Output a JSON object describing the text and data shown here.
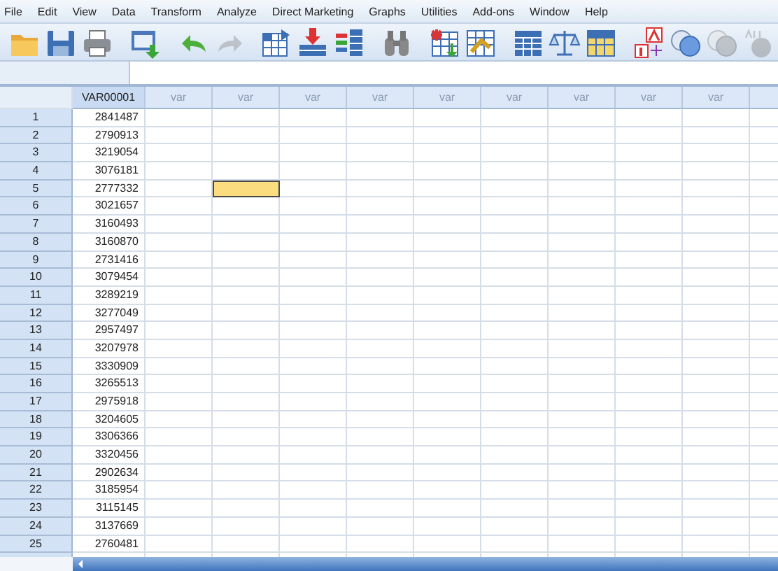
{
  "menu": [
    "File",
    "Edit",
    "View",
    "Data",
    "Transform",
    "Analyze",
    "Direct Marketing",
    "Graphs",
    "Utilities",
    "Add-ons",
    "Window",
    "Help"
  ],
  "toolbar": [
    {
      "kind": "folder",
      "disabled": false
    },
    {
      "kind": "save",
      "disabled": false
    },
    {
      "kind": "print",
      "disabled": false
    },
    {
      "kind": "dialog",
      "disabled": false
    },
    {
      "kind": "undo",
      "disabled": false
    },
    {
      "kind": "redo",
      "disabled": true
    },
    {
      "kind": "grid-arrow",
      "disabled": false
    },
    {
      "kind": "grid-down",
      "disabled": false
    },
    {
      "kind": "variables",
      "disabled": false
    },
    {
      "kind": "find",
      "disabled": false
    },
    {
      "kind": "insert",
      "disabled": false
    },
    {
      "kind": "split",
      "disabled": false
    },
    {
      "kind": "table",
      "disabled": false
    },
    {
      "kind": "scale",
      "disabled": false
    },
    {
      "kind": "table-yellow",
      "disabled": false
    },
    {
      "kind": "labels",
      "disabled": false
    },
    {
      "kind": "circles",
      "disabled": false
    },
    {
      "kind": "circles",
      "disabled": true
    },
    {
      "kind": "spell",
      "disabled": true
    }
  ],
  "columns": [
    "VAR00001",
    "var",
    "var",
    "var",
    "var",
    "var",
    "var",
    "var",
    "var",
    "var"
  ],
  "rows": [
    {
      "case": "1",
      "value": "2841487",
      "cells": [
        {
          "selected": false
        },
        {
          "selected": false
        },
        {
          "selected": false
        },
        {
          "selected": false
        },
        {
          "selected": false
        },
        {
          "selected": false
        },
        {
          "selected": false
        },
        {
          "selected": false
        },
        {
          "selected": false
        }
      ]
    },
    {
      "case": "2",
      "value": "2790913",
      "cells": [
        {
          "selected": false
        },
        {
          "selected": false
        },
        {
          "selected": false
        },
        {
          "selected": false
        },
        {
          "selected": false
        },
        {
          "selected": false
        },
        {
          "selected": false
        },
        {
          "selected": false
        },
        {
          "selected": false
        }
      ]
    },
    {
      "case": "3",
      "value": "3219054",
      "cells": [
        {
          "selected": false
        },
        {
          "selected": false
        },
        {
          "selected": false
        },
        {
          "selected": false
        },
        {
          "selected": false
        },
        {
          "selected": false
        },
        {
          "selected": false
        },
        {
          "selected": false
        },
        {
          "selected": false
        }
      ]
    },
    {
      "case": "4",
      "value": "3076181",
      "cells": [
        {
          "selected": false
        },
        {
          "selected": false
        },
        {
          "selected": false
        },
        {
          "selected": false
        },
        {
          "selected": false
        },
        {
          "selected": false
        },
        {
          "selected": false
        },
        {
          "selected": false
        },
        {
          "selected": false
        }
      ]
    },
    {
      "case": "5",
      "value": "2777332",
      "cells": [
        {
          "selected": false
        },
        {
          "selected": true
        },
        {
          "selected": false
        },
        {
          "selected": false
        },
        {
          "selected": false
        },
        {
          "selected": false
        },
        {
          "selected": false
        },
        {
          "selected": false
        },
        {
          "selected": false
        }
      ]
    },
    {
      "case": "6",
      "value": "3021657",
      "cells": [
        {
          "selected": false
        },
        {
          "selected": false
        },
        {
          "selected": false
        },
        {
          "selected": false
        },
        {
          "selected": false
        },
        {
          "selected": false
        },
        {
          "selected": false
        },
        {
          "selected": false
        },
        {
          "selected": false
        }
      ]
    },
    {
      "case": "7",
      "value": "3160493",
      "cells": [
        {
          "selected": false
        },
        {
          "selected": false
        },
        {
          "selected": false
        },
        {
          "selected": false
        },
        {
          "selected": false
        },
        {
          "selected": false
        },
        {
          "selected": false
        },
        {
          "selected": false
        },
        {
          "selected": false
        }
      ]
    },
    {
      "case": "8",
      "value": "3160870",
      "cells": [
        {
          "selected": false
        },
        {
          "selected": false
        },
        {
          "selected": false
        },
        {
          "selected": false
        },
        {
          "selected": false
        },
        {
          "selected": false
        },
        {
          "selected": false
        },
        {
          "selected": false
        },
        {
          "selected": false
        }
      ]
    },
    {
      "case": "9",
      "value": "2731416",
      "cells": [
        {
          "selected": false
        },
        {
          "selected": false
        },
        {
          "selected": false
        },
        {
          "selected": false
        },
        {
          "selected": false
        },
        {
          "selected": false
        },
        {
          "selected": false
        },
        {
          "selected": false
        },
        {
          "selected": false
        }
      ]
    },
    {
      "case": "10",
      "value": "3079454",
      "cells": [
        {
          "selected": false
        },
        {
          "selected": false
        },
        {
          "selected": false
        },
        {
          "selected": false
        },
        {
          "selected": false
        },
        {
          "selected": false
        },
        {
          "selected": false
        },
        {
          "selected": false
        },
        {
          "selected": false
        }
      ]
    },
    {
      "case": "11",
      "value": "3289219",
      "cells": [
        {
          "selected": false
        },
        {
          "selected": false
        },
        {
          "selected": false
        },
        {
          "selected": false
        },
        {
          "selected": false
        },
        {
          "selected": false
        },
        {
          "selected": false
        },
        {
          "selected": false
        },
        {
          "selected": false
        }
      ]
    },
    {
      "case": "12",
      "value": "3277049",
      "cells": [
        {
          "selected": false
        },
        {
          "selected": false
        },
        {
          "selected": false
        },
        {
          "selected": false
        },
        {
          "selected": false
        },
        {
          "selected": false
        },
        {
          "selected": false
        },
        {
          "selected": false
        },
        {
          "selected": false
        }
      ]
    },
    {
      "case": "13",
      "value": "2957497",
      "cells": [
        {
          "selected": false
        },
        {
          "selected": false
        },
        {
          "selected": false
        },
        {
          "selected": false
        },
        {
          "selected": false
        },
        {
          "selected": false
        },
        {
          "selected": false
        },
        {
          "selected": false
        },
        {
          "selected": false
        }
      ]
    },
    {
      "case": "14",
      "value": "3207978",
      "cells": [
        {
          "selected": false
        },
        {
          "selected": false
        },
        {
          "selected": false
        },
        {
          "selected": false
        },
        {
          "selected": false
        },
        {
          "selected": false
        },
        {
          "selected": false
        },
        {
          "selected": false
        },
        {
          "selected": false
        }
      ]
    },
    {
      "case": "15",
      "value": "3330909",
      "cells": [
        {
          "selected": false
        },
        {
          "selected": false
        },
        {
          "selected": false
        },
        {
          "selected": false
        },
        {
          "selected": false
        },
        {
          "selected": false
        },
        {
          "selected": false
        },
        {
          "selected": false
        },
        {
          "selected": false
        }
      ]
    },
    {
      "case": "16",
      "value": "3265513",
      "cells": [
        {
          "selected": false
        },
        {
          "selected": false
        },
        {
          "selected": false
        },
        {
          "selected": false
        },
        {
          "selected": false
        },
        {
          "selected": false
        },
        {
          "selected": false
        },
        {
          "selected": false
        },
        {
          "selected": false
        }
      ]
    },
    {
      "case": "17",
      "value": "2975918",
      "cells": [
        {
          "selected": false
        },
        {
          "selected": false
        },
        {
          "selected": false
        },
        {
          "selected": false
        },
        {
          "selected": false
        },
        {
          "selected": false
        },
        {
          "selected": false
        },
        {
          "selected": false
        },
        {
          "selected": false
        }
      ]
    },
    {
      "case": "18",
      "value": "3204605",
      "cells": [
        {
          "selected": false
        },
        {
          "selected": false
        },
        {
          "selected": false
        },
        {
          "selected": false
        },
        {
          "selected": false
        },
        {
          "selected": false
        },
        {
          "selected": false
        },
        {
          "selected": false
        },
        {
          "selected": false
        }
      ]
    },
    {
      "case": "19",
      "value": "3306366",
      "cells": [
        {
          "selected": false
        },
        {
          "selected": false
        },
        {
          "selected": false
        },
        {
          "selected": false
        },
        {
          "selected": false
        },
        {
          "selected": false
        },
        {
          "selected": false
        },
        {
          "selected": false
        },
        {
          "selected": false
        }
      ]
    },
    {
      "case": "20",
      "value": "3320456",
      "cells": [
        {
          "selected": false
        },
        {
          "selected": false
        },
        {
          "selected": false
        },
        {
          "selected": false
        },
        {
          "selected": false
        },
        {
          "selected": false
        },
        {
          "selected": false
        },
        {
          "selected": false
        },
        {
          "selected": false
        }
      ]
    },
    {
      "case": "21",
      "value": "2902634",
      "cells": [
        {
          "selected": false
        },
        {
          "selected": false
        },
        {
          "selected": false
        },
        {
          "selected": false
        },
        {
          "selected": false
        },
        {
          "selected": false
        },
        {
          "selected": false
        },
        {
          "selected": false
        },
        {
          "selected": false
        }
      ]
    },
    {
      "case": "22",
      "value": "3185954",
      "cells": [
        {
          "selected": false
        },
        {
          "selected": false
        },
        {
          "selected": false
        },
        {
          "selected": false
        },
        {
          "selected": false
        },
        {
          "selected": false
        },
        {
          "selected": false
        },
        {
          "selected": false
        },
        {
          "selected": false
        }
      ]
    },
    {
      "case": "23",
      "value": "3115145",
      "cells": [
        {
          "selected": false
        },
        {
          "selected": false
        },
        {
          "selected": false
        },
        {
          "selected": false
        },
        {
          "selected": false
        },
        {
          "selected": false
        },
        {
          "selected": false
        },
        {
          "selected": false
        },
        {
          "selected": false
        }
      ]
    },
    {
      "case": "24",
      "value": "3137669",
      "cells": [
        {
          "selected": false
        },
        {
          "selected": false
        },
        {
          "selected": false
        },
        {
          "selected": false
        },
        {
          "selected": false
        },
        {
          "selected": false
        },
        {
          "selected": false
        },
        {
          "selected": false
        },
        {
          "selected": false
        }
      ]
    },
    {
      "case": "25",
      "value": "2760481",
      "cells": [
        {
          "selected": false
        },
        {
          "selected": false
        },
        {
          "selected": false
        },
        {
          "selected": false
        },
        {
          "selected": false
        },
        {
          "selected": false
        },
        {
          "selected": false
        },
        {
          "selected": false
        },
        {
          "selected": false
        }
      ]
    }
  ]
}
